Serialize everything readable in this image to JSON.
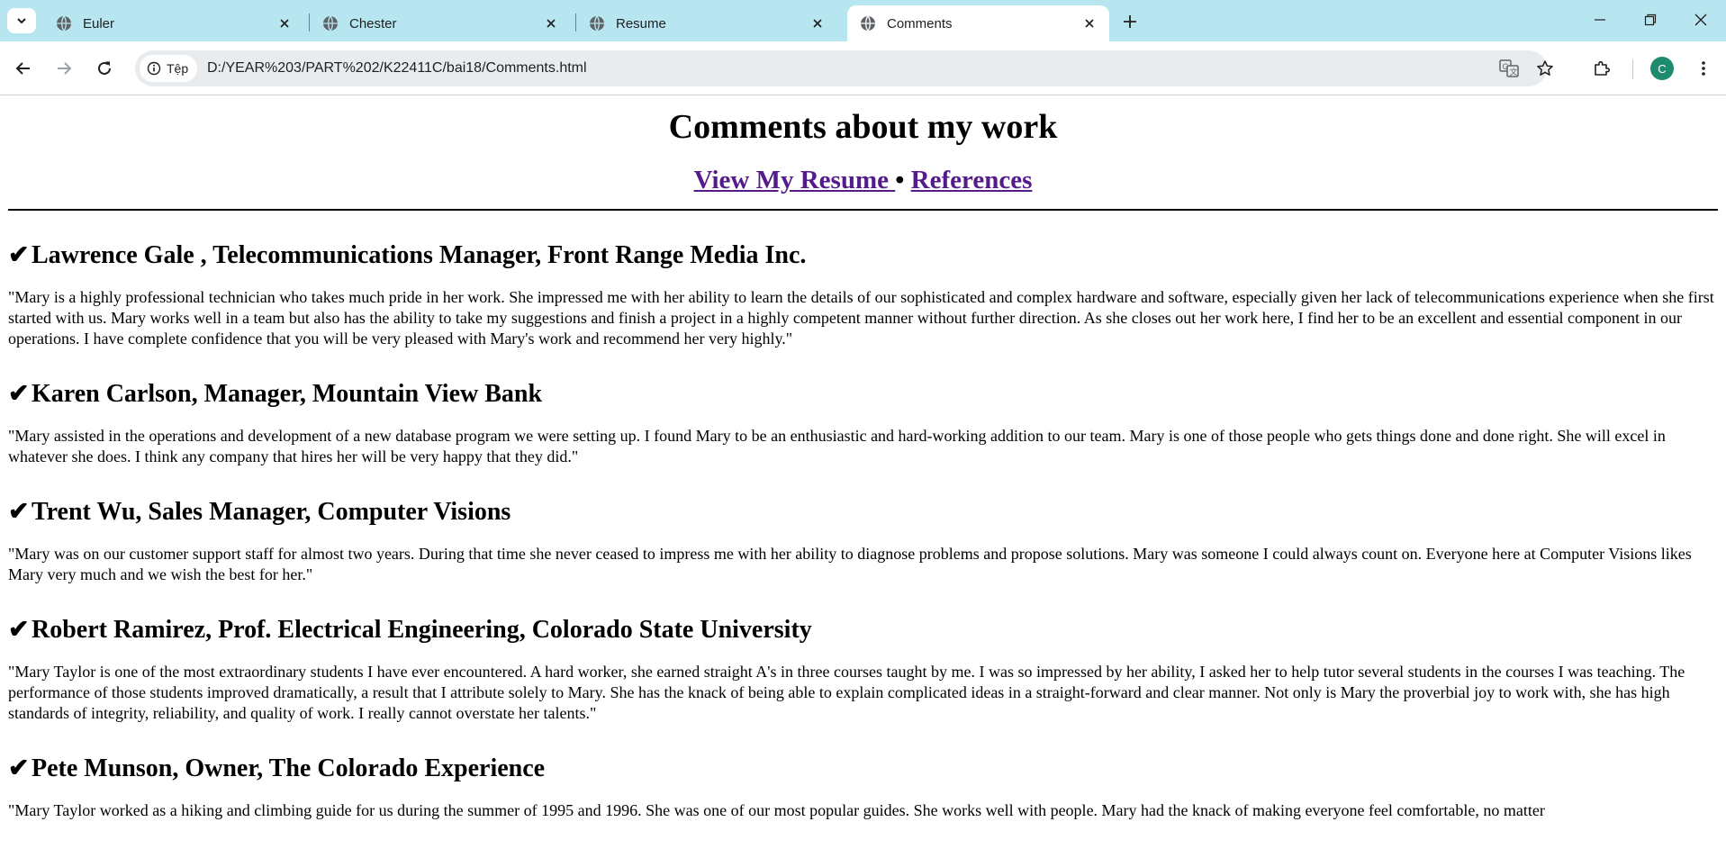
{
  "browser": {
    "tabs": [
      {
        "title": "Euler",
        "active": false
      },
      {
        "title": "Chester",
        "active": false
      },
      {
        "title": "Resume",
        "active": false
      },
      {
        "title": "Comments",
        "active": true
      }
    ],
    "site_chip": "Tệp",
    "url": "D:/YEAR%203/PART%202/K22411C/bai18/Comments.html",
    "profile_initial": "C",
    "colors": {
      "tabstrip": "#b7e6f0",
      "avatar": "#1e8a6e",
      "link_visited": "#551a8b"
    }
  },
  "page": {
    "title": "Comments about my work",
    "links": {
      "resume": "View My Resume ",
      "separator": "•",
      "references": "References"
    },
    "entries": [
      {
        "check": "✔",
        "heading": "Lawrence Gale , Telecommunications Manager, Front Range Media Inc.",
        "text": "\"Mary is a highly professional technician who takes much pride in her work. She impressed me with her ability to learn the details of our sophisticated and complex hardware and software, especially given her lack of telecommunications experience when she first started with us. Mary works well in a team but also has the ability to take my suggestions and finish a project in a highly competent manner without further direction. As she closes out her work here, I find her to be an excellent and essential component in our operations. I have complete confidence that you will be very pleased with Mary's work and recommend her very highly.\""
      },
      {
        "check": "✔",
        "heading": "Karen Carlson, Manager, Mountain View Bank",
        "text": "\"Mary assisted in the operations and development of a new database program we were setting up. I found Mary to be an enthusiastic and hard-working addition to our team. Mary is one of those people who gets things done and done right. She will excel in whatever she does. I think any company that hires her will be very happy that they did.\""
      },
      {
        "check": "✔",
        "heading": "Trent Wu, Sales Manager, Computer Visions",
        "text": "\"Mary was on our customer support staff for almost two years. During that time she never ceased to impress me with her ability to diagnose problems and propose solutions. Mary was someone I could always count on. Everyone here at Computer Visions likes Mary very much and we wish the best for her.\""
      },
      {
        "check": "✔",
        "heading": "Robert Ramirez, Prof. Electrical Engineering, Colorado State University",
        "text": "\"Mary Taylor is one of the most extraordinary students I have ever encountered. A hard worker, she earned straight A's in three courses taught by me. I was so impressed by her ability, I asked her to help tutor several students in the courses I was teaching. The performance of those students improved dramatically, a result that I attribute solely to Mary. She has the knack of being able to explain complicated ideas in a straight-forward and clear manner. Not only is Mary the proverbial joy to work with, she has high standards of integrity, reliability, and quality of work. I really cannot overstate her talents.\""
      },
      {
        "check": "✔",
        "heading": "Pete Munson, Owner, The Colorado Experience",
        "text": "\"Mary Taylor worked as a hiking and climbing guide for us during the summer of 1995 and 1996. She was one of our most popular guides. She works well with people. Mary had the knack of making everyone feel comfortable, no matter"
      }
    ]
  }
}
